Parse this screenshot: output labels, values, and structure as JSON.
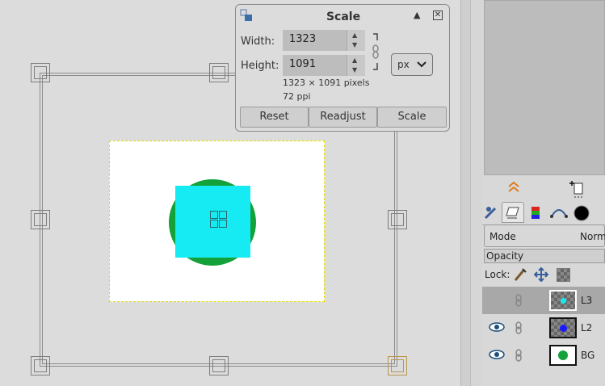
{
  "dialog": {
    "title": "Scale",
    "width_label": "Width:",
    "width_value": "1323",
    "height_label": "Height:",
    "height_value": "1091",
    "unit": "px",
    "info_size": "1323 × 1091 pixels",
    "info_res": "72 ppi",
    "buttons": {
      "reset": "Reset",
      "readjust": "Readjust",
      "scale": "Scale"
    }
  },
  "layers_panel": {
    "mode_label": "Mode",
    "mode_value": "Norm",
    "opacity_label": "Opacity",
    "lock_label": "Lock:",
    "layers": [
      {
        "name": "L3",
        "visible": false,
        "thumb_color": "#16eaf2"
      },
      {
        "name": "L2",
        "visible": true,
        "thumb_color": "#1a1aff"
      },
      {
        "name": "BG",
        "visible": true,
        "thumb_color": "#13a13a"
      }
    ]
  },
  "colors": {
    "cyan": "#16eaf2",
    "green": "#13a13a",
    "accent_orange": "#e07a1a"
  }
}
